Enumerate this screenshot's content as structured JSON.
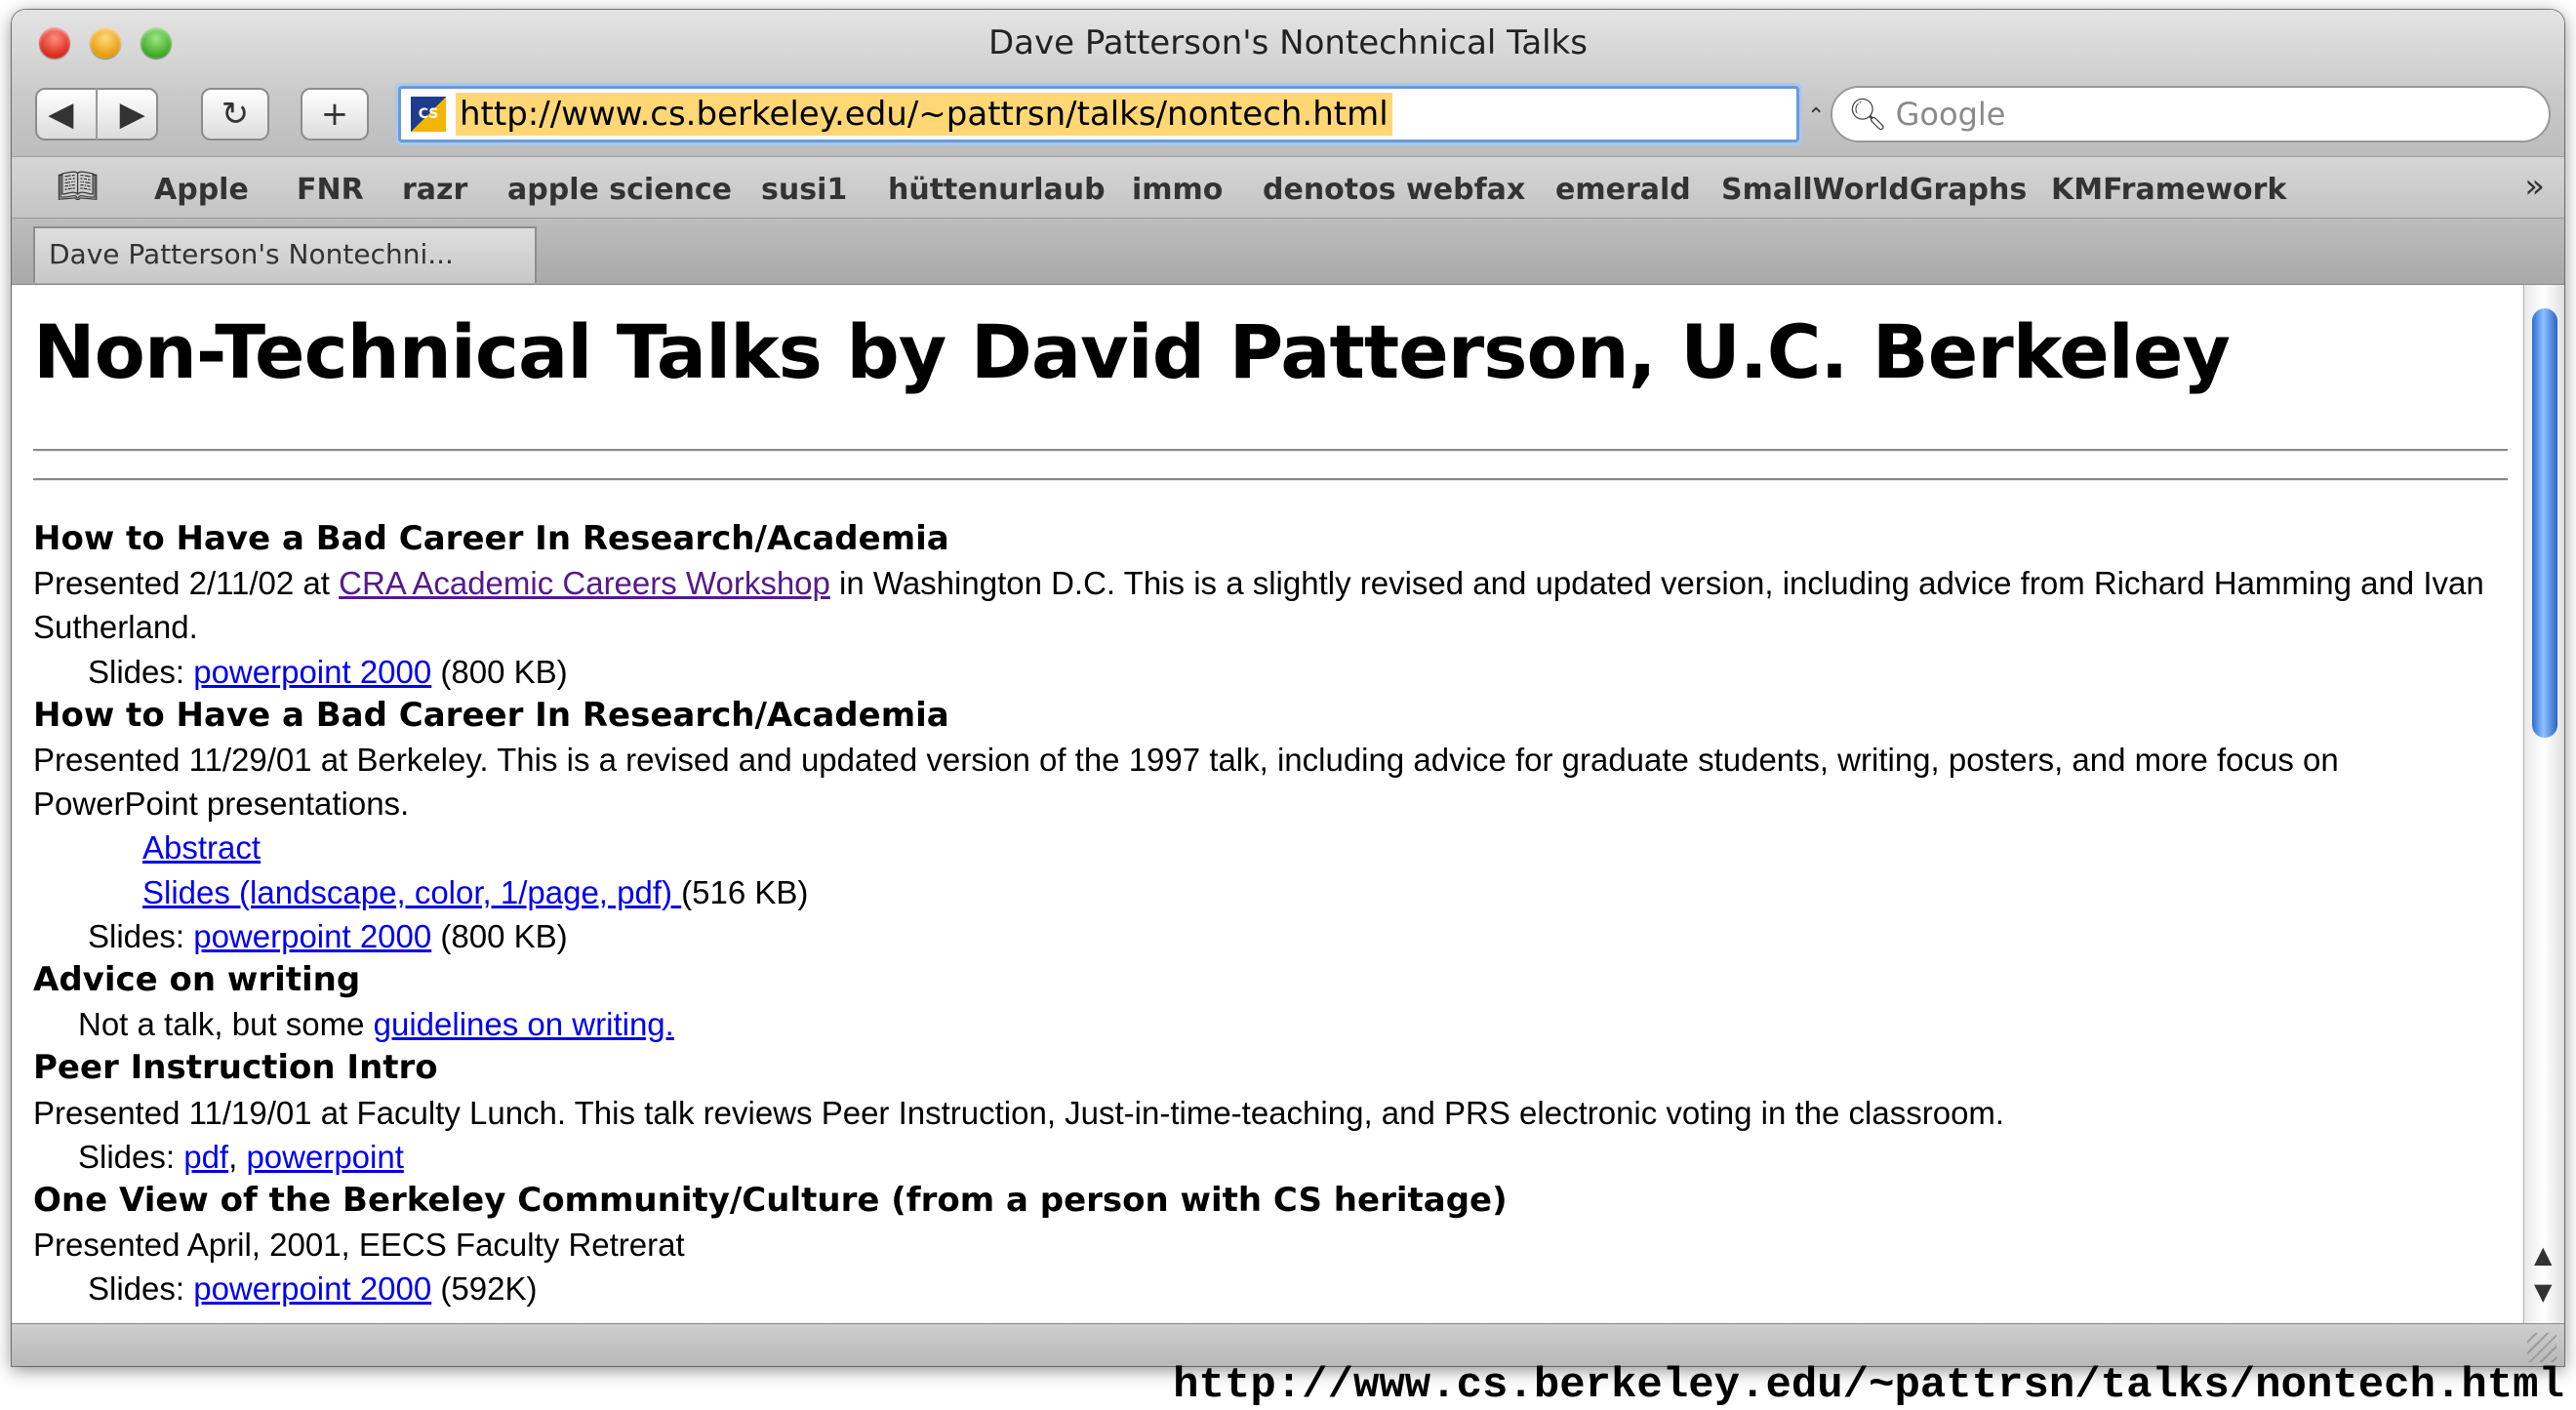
{
  "window": {
    "title": "Dave Patterson's Nontechnical Talks"
  },
  "toolbar": {
    "back_icon": "back-arrow-icon",
    "forward_icon": "forward-arrow-icon",
    "reload_icon": "reload-icon",
    "add_icon": "plus-icon",
    "address_value": "http://www.cs.berkeley.edu/~pattrsn/talks/nontech.html",
    "search_placeholder": "Google"
  },
  "bookmarks": [
    "Apple",
    "FNR",
    "razr",
    "apple science",
    "susi1",
    "hüttenurlaub",
    "immo",
    "denotos webfax",
    "emerald",
    "SmallWorldGraphs",
    "KMFramework"
  ],
  "tab": {
    "label": "Dave Patterson's Nontechni..."
  },
  "page": {
    "title": "Non-Technical Talks by David Patterson, U.C. Berkeley",
    "entries": [
      {
        "heading": "How to Have a Bad Career In Research/Academia",
        "desc_pre": "Presented 2/11/02 at ",
        "desc_link": "CRA Academic Careers Workshop",
        "desc_post": " in Washington D.C. This is a slightly revised and updated version, including advice from Richard Hamming and Ivan Sutherland.",
        "slides_label": "Slides: ",
        "slides_link": "powerpoint 2000",
        "slides_size": " (800  KB)"
      },
      {
        "heading": "How to Have a Bad Career In Research/Academia",
        "desc": "Presented 11/29/01 at Berkeley. This is a revised and updated version of the 1997 talk, including advice for graduate students, writing, posters, and more focus on PowerPoint presentations.",
        "abstract_link": "Abstract",
        "pdf_link": "Slides (landscape, color, 1/page, pdf) ",
        "pdf_size": "(516 KB)",
        "slides_label": "Slides: ",
        "slides_link": "powerpoint 2000",
        "slides_size": " (800  KB)"
      },
      {
        "heading": "Advice on writing",
        "desc_pre": "Not a talk, but some ",
        "desc_link": "guidelines on writing."
      },
      {
        "heading": "Peer Instruction Intro",
        "desc": "Presented 11/19/01 at Faculty Lunch. This talk reviews Peer Instruction, Just-in-time-teaching, and PRS electronic voting in the classroom.",
        "slides_label": "Slides: ",
        "slides_link_1": "pdf",
        "slides_sep": ", ",
        "slides_link_2": "powerpoint"
      },
      {
        "heading": "One View of the Berkeley Community/Culture (from a person with CS heritage)",
        "desc": "Presented April, 2001, EECS Faculty Retrerat",
        "slides_label": "Slides: ",
        "slides_link": "powerpoint 2000",
        "slides_size": " (592K)"
      }
    ]
  },
  "caption": "http://www.cs.berkeley.edu/~pattrsn/talks/nontech.html",
  "colors": {
    "link": "#0000ee",
    "visited_link": "#551a8b",
    "address_highlight": "#ffd775",
    "focus_ring": "#6a9bd7"
  }
}
